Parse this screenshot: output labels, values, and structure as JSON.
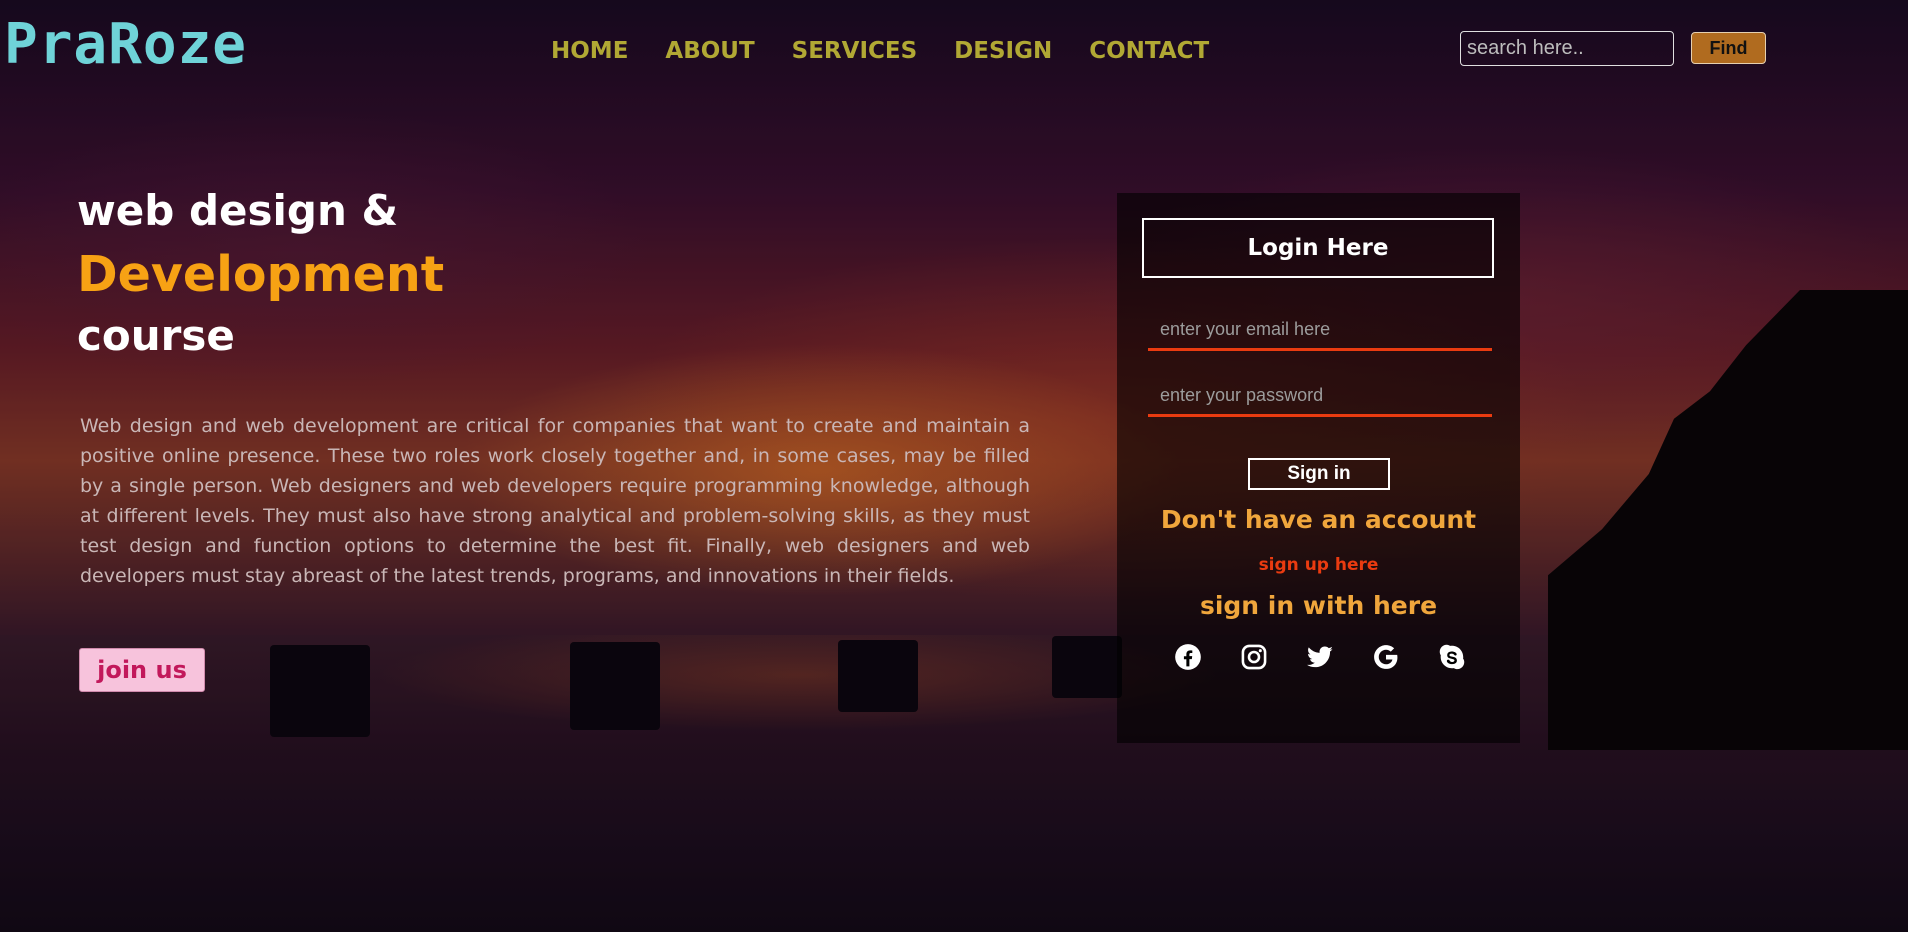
{
  "brand": {
    "logo": "PraRoze"
  },
  "nav": {
    "items": [
      {
        "label": "HOME"
      },
      {
        "label": "ABOUT"
      },
      {
        "label": "SERVICES"
      },
      {
        "label": "DESIGN"
      },
      {
        "label": "CONTACT"
      }
    ]
  },
  "search": {
    "placeholder": "search here..",
    "button_label": "Find"
  },
  "hero": {
    "line1": "web design &",
    "line2": "Development",
    "line3": "course",
    "paragraph": "Web design and web development are critical for companies that want to create and maintain a positive online presence. These two roles work closely together and, in some cases, may be filled by a single person. Web designers and web developers require programming knowledge, although at different levels. They must also have strong analytical and problem-solving skills, as they must test design and function options to determine the best fit. Finally, web designers and web developers must stay abreast of the latest trends, programs, and innovations in their fields.",
    "join_label": "join us"
  },
  "login": {
    "title": "Login Here",
    "email_placeholder": "enter your email here",
    "password_placeholder": "enter your password",
    "signin_label": "Sign in",
    "no_account": "Don't have an account",
    "signup_link": "sign up here",
    "signin_with": "sign in with here",
    "socials": [
      "facebook-icon",
      "instagram-icon",
      "twitter-icon",
      "google-icon",
      "skype-icon"
    ]
  },
  "colors": {
    "logo": "#6fd3d8",
    "nav": "#b1a834",
    "accent_orange": "#f7a214",
    "field_underline": "#ea3b10",
    "join_bg": "#f7c3dc",
    "find_bg": "#b06b1f"
  }
}
